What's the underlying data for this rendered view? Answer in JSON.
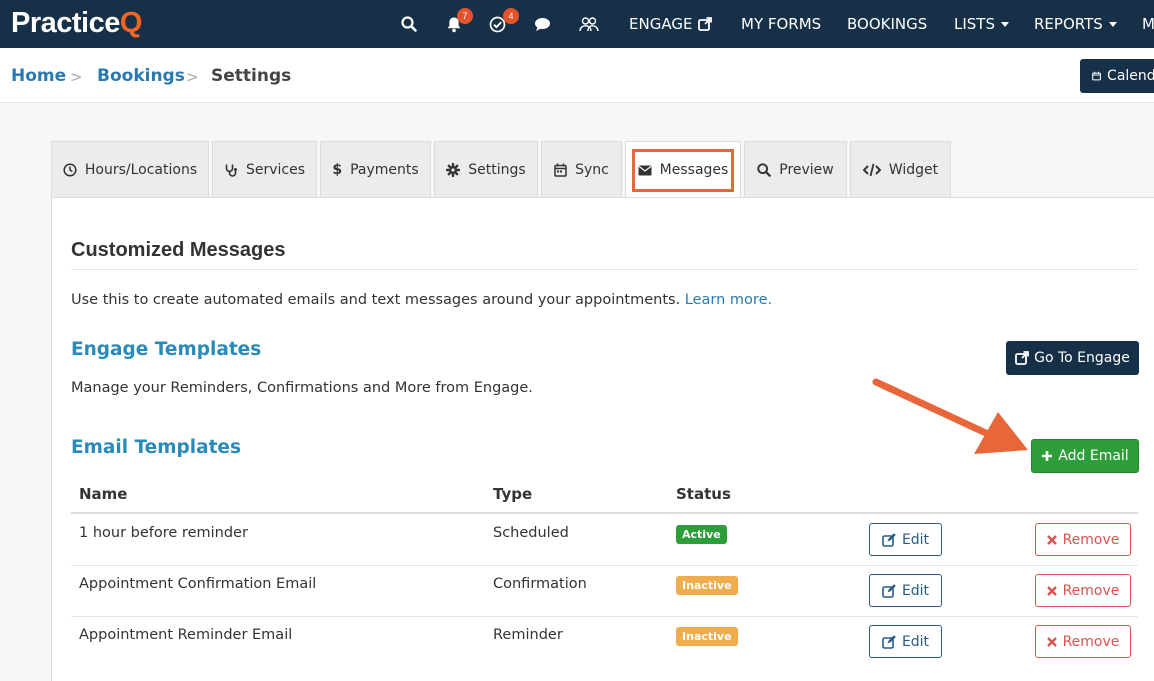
{
  "app": {
    "logo_main": "Practice",
    "logo_accent": "Q"
  },
  "topnav": {
    "notifications_count": "7",
    "tasks_count": "4",
    "links": [
      "ENGAGE",
      "MY FORMS",
      "BOOKINGS",
      "LISTS",
      "REPORTS",
      "M"
    ]
  },
  "breadcrumb": {
    "home": "Home",
    "bookings": "Bookings",
    "current": "Settings",
    "sep": ">"
  },
  "calendar_button": "Calendar",
  "tabs": [
    {
      "label": "Hours/Locations",
      "icon": "clock-icon"
    },
    {
      "label": "Services",
      "icon": "stethoscope-icon"
    },
    {
      "label": "Payments",
      "icon": "dollar-icon"
    },
    {
      "label": "Settings",
      "icon": "gear-icon"
    },
    {
      "label": "Sync",
      "icon": "calendar-icon"
    },
    {
      "label": "Messages",
      "icon": "envelope-icon"
    },
    {
      "label": "Preview",
      "icon": "search-icon"
    },
    {
      "label": "Widget",
      "icon": "code-icon"
    }
  ],
  "main": {
    "title": "Customized Messages",
    "description": "Use this to create automated emails and text messages around your appointments.",
    "learn_more": "Learn more.",
    "engage_section": {
      "title": "Engage Templates",
      "description": "Manage your Reminders, Confirmations and More from Engage.",
      "button": "Go To Engage"
    },
    "email_section": {
      "title": "Email Templates",
      "add_button": "Add Email"
    }
  },
  "table": {
    "headers": {
      "name": "Name",
      "type": "Type",
      "status": "Status"
    },
    "rows": [
      {
        "name": "1 hour before reminder",
        "type": "Scheduled",
        "status": "Active"
      },
      {
        "name": "Appointment Confirmation Email",
        "type": "Confirmation",
        "status": "Inactive"
      },
      {
        "name": "Appointment Reminder Email",
        "type": "Reminder",
        "status": "Inactive"
      }
    ],
    "edit_label": "Edit",
    "remove_label": "Remove"
  },
  "colors": {
    "nav_bg": "#163047",
    "accent_orange": "#f26522",
    "link_blue": "#2a7ab0",
    "success_green": "#2e9e3a",
    "warning_orange": "#f0ad4e",
    "danger_red": "#d9534f"
  }
}
